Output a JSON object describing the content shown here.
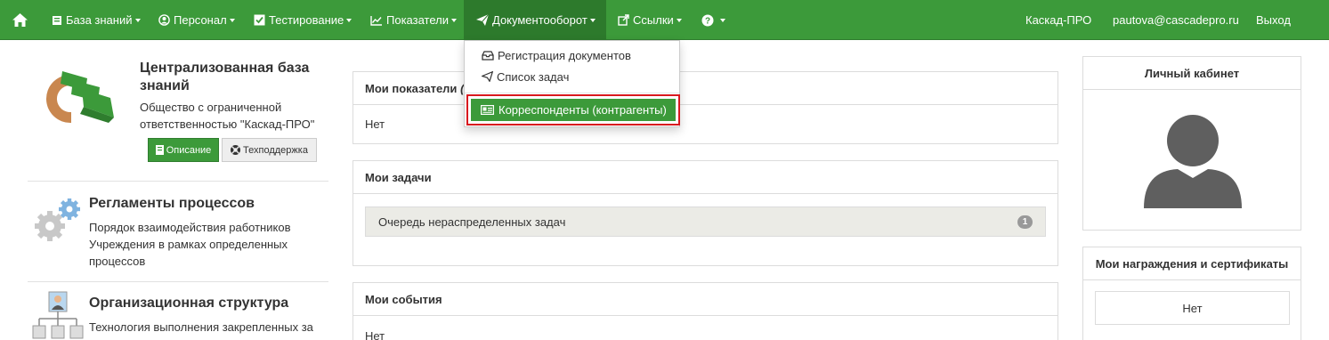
{
  "navbar": {
    "items": [
      {
        "label": "База знаний",
        "icon": "book-icon"
      },
      {
        "label": "Персонал",
        "icon": "user-circle-icon"
      },
      {
        "label": "Тестирование",
        "icon": "checkbox-icon"
      },
      {
        "label": "Показатели",
        "icon": "line-chart-icon"
      },
      {
        "label": "Документооборот",
        "icon": "paper-plane-icon",
        "active": true
      },
      {
        "label": "Ссылки",
        "icon": "external-link-icon"
      }
    ],
    "right": {
      "company": "Каскад-ПРО",
      "email": "pautova@cascadepro.ru",
      "logout": "Выход"
    }
  },
  "dropdown": {
    "items": [
      {
        "label": "Регистрация документов",
        "icon": "inbox-icon"
      },
      {
        "label": "Список задач",
        "icon": "paper-plane-icon"
      }
    ],
    "highlighted": {
      "label": "Корреспонденты (контрагенты)",
      "icon": "id-card-icon"
    }
  },
  "org": {
    "title": "Централизованная база знаний",
    "description": "Общество с ограниченной ответственностью \"Каскад-ПРО\"",
    "btn_description": "Описание",
    "btn_support": "Техподдержка"
  },
  "sections": [
    {
      "title": "Регламенты процессов",
      "text": "Порядок взаимодействия работников Учреждения в рамках определенных процессов"
    },
    {
      "title": "Организационная структура",
      "text": "Технология выполнения закрепленных за"
    }
  ],
  "panels": {
    "indicators": {
      "title": "Мои показатели",
      "title_suffix": "(4",
      "value": "Нет"
    },
    "tasks": {
      "title": "Мои задачи",
      "queue_label": "Очередь нераспределенных задач",
      "queue_count": "1"
    },
    "events": {
      "title": "Мои события",
      "value": "Нет"
    }
  },
  "right": {
    "cabinet_title": "Личный кабинет",
    "awards_title": "Мои награждения и сертификаты",
    "awards_value": "Нет"
  },
  "colors": {
    "brand_green": "#3c9a3a",
    "active_green": "#2d7a2c",
    "highlight_red": "#d9181f"
  }
}
